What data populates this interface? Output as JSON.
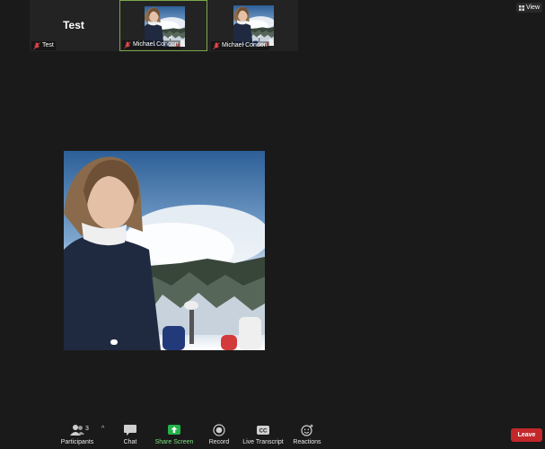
{
  "thumbnails": [
    {
      "big_name": "Test",
      "label": "Test"
    },
    {
      "label": "Michael Condon"
    },
    {
      "label": "Michael Condon"
    }
  ],
  "view_button": {
    "label": "View",
    "icon": "grid-icon"
  },
  "toolbar": {
    "participants_label": "Participants",
    "participants_count": "3",
    "chat_label": "Chat",
    "share_label": "Share Screen",
    "record_label": "Record",
    "transcript_label": "Live Transcript",
    "reactions_label": "Reactions",
    "leave_label": "Leave"
  },
  "colors": {
    "background": "#1a1a1a",
    "active_speaker_border": "#7ba84a",
    "share_green": "#23b34a",
    "leave_red": "#c4272a",
    "mic_off_red": "#e0464a"
  }
}
